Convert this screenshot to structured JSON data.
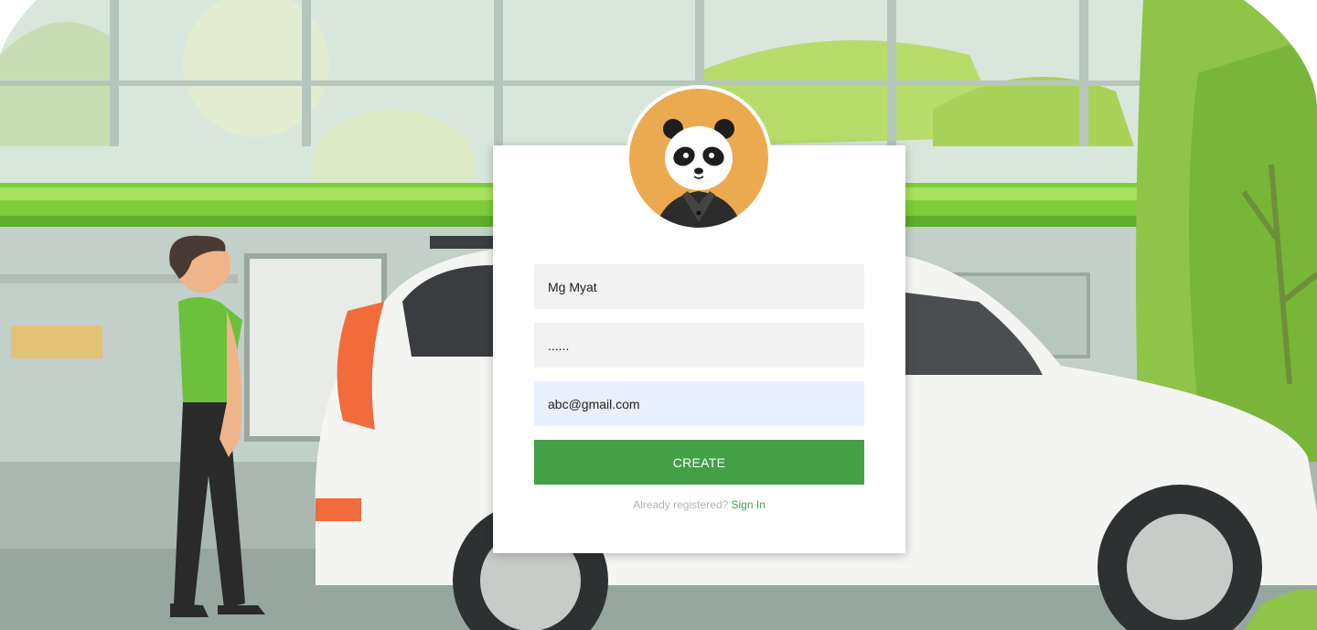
{
  "form": {
    "username_value": "Mg Myat",
    "password_value": "......",
    "email_value": "abc@gmail.com",
    "create_label": "CREATE",
    "message_text": "Already registered?",
    "signin_label": "Sign In"
  },
  "colors": {
    "accent": "#43a047",
    "avatar_bg": "#ecaa50",
    "input_bg": "#f2f2f2",
    "autofill_bg": "#e8f0fe"
  },
  "icons": {
    "avatar": "panda-avatar-icon"
  }
}
